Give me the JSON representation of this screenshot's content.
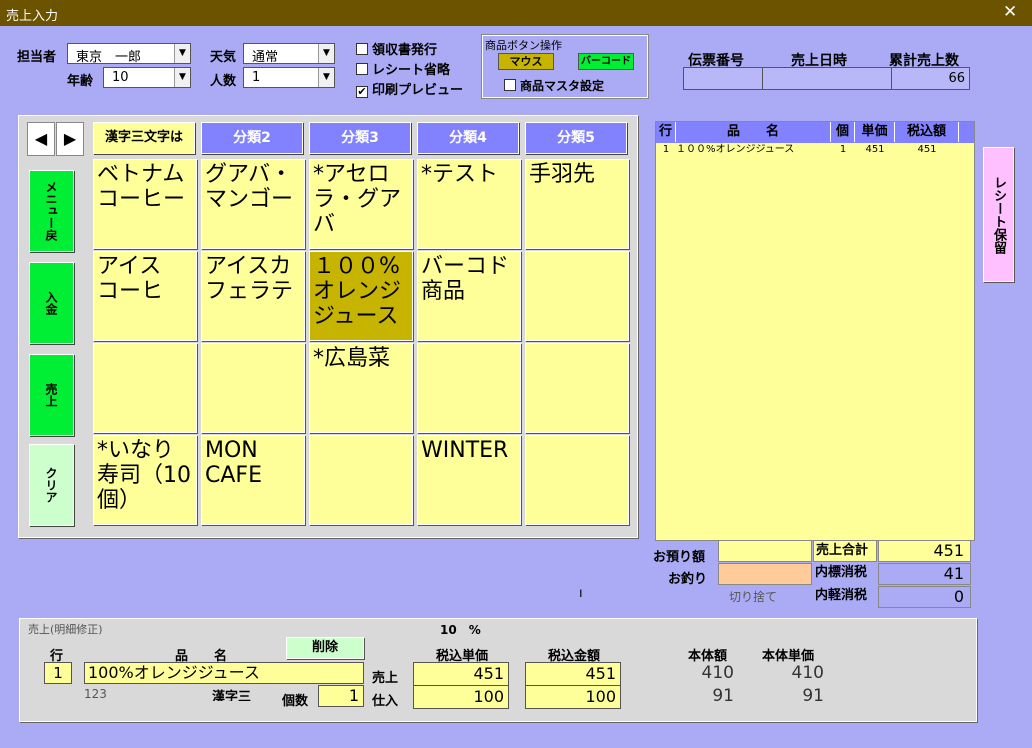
{
  "window": {
    "title": "売上入力",
    "close": "✕"
  },
  "staff": {
    "label": "担当者",
    "value": "東京　一郎"
  },
  "age": {
    "label": "年齢",
    "value": "10"
  },
  "weather": {
    "label": "天気",
    "value": "通常"
  },
  "people": {
    "label": "人数",
    "value": "1"
  },
  "options": {
    "receipt": "領収書発行",
    "omit_receipt": "レシート省略",
    "print_preview": "印刷プレビュー"
  },
  "product_btn_op": {
    "title": "商品ボタン操作",
    "mouse": "マウス",
    "barcode": "バーコード",
    "master": "商品マスタ設定"
  },
  "summary": {
    "slip_no_label": "伝票番号",
    "sales_datetime_label": "売上日時",
    "cumulative_label": "累計売上数",
    "slip_no": "",
    "sales_datetime": "",
    "cumulative": "66"
  },
  "nav": {
    "left": "◀",
    "right": "▶"
  },
  "categories": [
    "漢字三文字は",
    "分類2",
    "分類3",
    "分類4",
    "分類5"
  ],
  "side_buttons": {
    "menu_back": "メニュー戻",
    "deposit": "入金",
    "sales": "売上",
    "clear": "クリア"
  },
  "products": [
    "ベトナム\nコーヒー",
    "グアバ・\nマンゴー",
    "*アセロ\nラ・グア\nバ",
    "*テスト",
    "手羽先",
    "アイス\nコーヒ",
    "アイスカ\nフェラテ",
    "１００%\nオレンジ\nジュース",
    "バーコド\n商品",
    "",
    "",
    "",
    "*広島菜",
    "",
    "",
    "*いなり\n寿司（10\n個）",
    "MON\nCAFE",
    "",
    "WINTER",
    ""
  ],
  "detail_table": {
    "headers": [
      "行",
      "品　　名",
      "個",
      "単価",
      "税込額"
    ],
    "rows": [
      [
        "1",
        "１００%オレンジジュース",
        "1",
        "451",
        "451"
      ]
    ]
  },
  "receipt_hold": "レシート保留",
  "totals": {
    "deposit_label": "お預り額",
    "change_label": "お釣り",
    "deposit": "",
    "change": "",
    "round_label": "切り捨て",
    "sales_total_label": "売上合計",
    "sales_total": "451",
    "inner_std_tax_label": "内標消税",
    "inner_std_tax": "41",
    "inner_light_tax_label": "内軽消税",
    "inner_light_tax": "0",
    "mark": "ı"
  },
  "edit": {
    "title": "売上(明細修正)",
    "tax_rate": "10　%",
    "row_label": "行",
    "row": "1",
    "name_label": "品　　名",
    "name": "100%オレンジジュース",
    "code": "123",
    "category_short": "漢字三",
    "delete": "削除",
    "qty_label": "個数",
    "qty": "1",
    "sales_label": "売上",
    "purchase_label": "仕入",
    "tax_incl_unit_label": "税込単価",
    "tax_incl_amount_label": "税込金額",
    "base_amount_label": "本体額",
    "base_unit_label": "本体単価",
    "sales_unit": "451",
    "sales_amount": "451",
    "purchase_unit": "100",
    "purchase_amount": "100",
    "base_amount_s": "410",
    "base_unit_s": "410",
    "base_amount_p": "91",
    "base_unit_p": "91"
  }
}
